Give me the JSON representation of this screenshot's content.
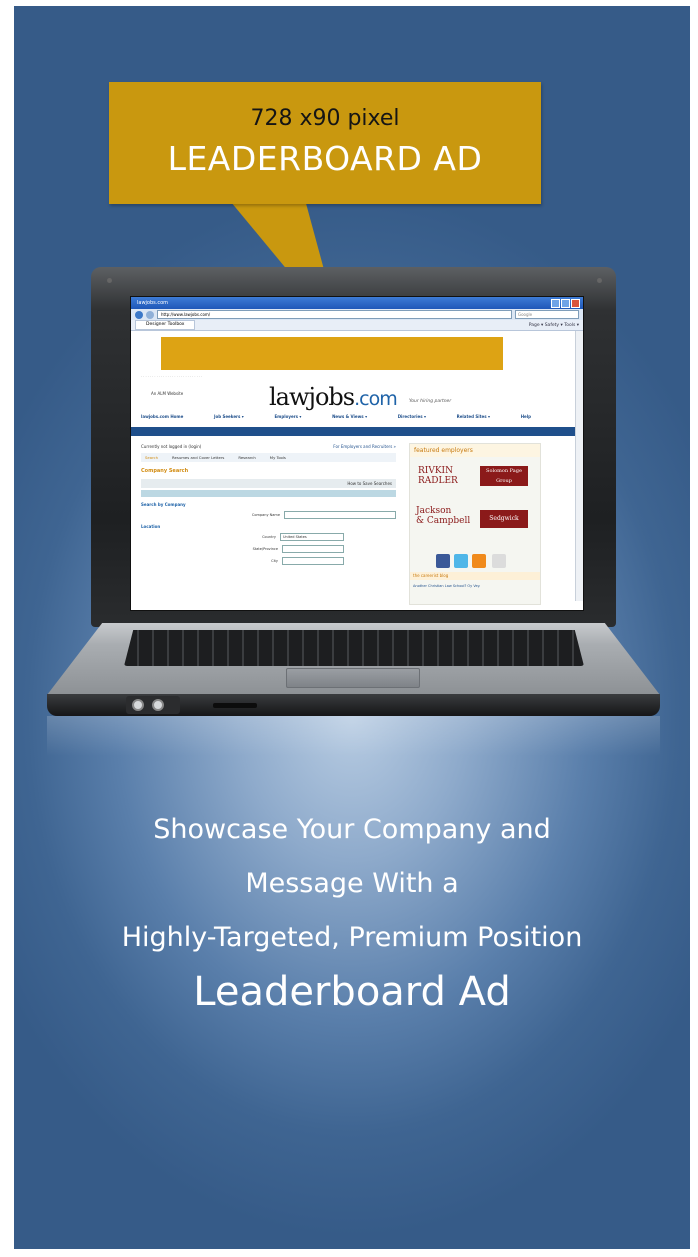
{
  "callout": {
    "line1": "728 x90 pixel",
    "line2": "LEADERBOARD AD",
    "color": "#c9980f"
  },
  "browser": {
    "window_title": "lawjobs.com",
    "address": "http://www.lawjobs.com/",
    "search_placeholder": "Google",
    "tab_label": "Designer Toolbox",
    "toolbar_right": "Page ▾  Safety ▾  Tools ▾"
  },
  "site": {
    "byline": "An ALM Website",
    "logo_main": "lawjobs",
    "logo_dot": ".com",
    "tagline": "Your hiring partner",
    "nav": [
      "lawjobs.com Home",
      "Job Seekers ▾",
      "Employers ▾",
      "News & Views ▾",
      "Directories ▾",
      "Related Sites ▾",
      "Help"
    ],
    "login_text": "Currently not logged in (login)",
    "employers_link": "For Employers and Recruiters »",
    "subtabs": [
      "Search",
      "Resumes and Cover Letters",
      "Research",
      "My Tools"
    ],
    "section_title": "Company Search",
    "save_searches": "How to Save Searches",
    "search_by": "Search by Company",
    "company_name_label": "Company Name",
    "location_label": "Location",
    "country_label": "Country",
    "country_value": "United States",
    "state_label": "State/Province",
    "city_label": "City",
    "featured_title": "featured employers",
    "employer1_line1": "RIVKIN",
    "employer1_line2": "RADLER",
    "employer2": "Solomon Page Group",
    "employer3_line1": "Jackson",
    "employer3_line2": "& Campbell",
    "employer4": "Sedgwick",
    "blog_title": "the careerist blog",
    "blog_entry": "Another Christian Law School? Oy Vey."
  },
  "headline": {
    "line1": "Showcase Your Company and",
    "line2": "Message With a",
    "line3": "Highly-Targeted, Premium Position",
    "big": "Leaderboard Ad"
  },
  "colors": {
    "background_blue": "#3f6592",
    "ad_gold": "#dda314",
    "site_blue": "#1f4f8b"
  }
}
